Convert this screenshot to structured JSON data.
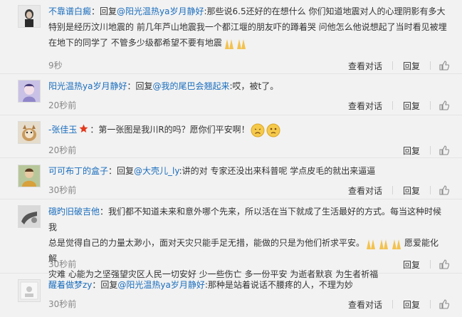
{
  "comments": [
    {
      "user": "不靠谱白癜",
      "reply_word": "：回复",
      "mention": "@阳光温热ya岁月静好",
      "text_prefix": ":",
      "text_l1": "那些说6.5还好的在想什么 你们知道地震对人的心理阴影有多大",
      "text_l2": "特别是经历汶川地震的 前几年芦山地震我一个都江堰的朋友吓的蹲着哭 问他怎么他说想起了当时看见被埋",
      "text_l3": "在地下的同学了 不管多少级都希望不要有地震",
      "time": "9秒",
      "actions": {
        "report": "查看对话",
        "reply": "回复"
      }
    },
    {
      "user": "阳光温热ya岁月静好",
      "reply_word": "：回复",
      "mention": "@我的尾巴会翘起来",
      "text": ":哎，被t了。",
      "time": "20秒前",
      "actions": {
        "report": "查看对话",
        "reply": "回复"
      }
    },
    {
      "user": "-张佳玉",
      "text": "：第一张图是我川R的吗？愿你们平安啊！",
      "time": "20秒前",
      "actions": {
        "reply": "回复"
      }
    },
    {
      "user": "可可布丁的盒子",
      "reply_word": "：回复",
      "mention": "@大壳儿_ly",
      "text": ":讲的对 专家还没出来科普呢 学点皮毛的就出来逼逼",
      "time": "30秒前",
      "actions": {
        "report": "查看对话",
        "reply": "回复"
      }
    },
    {
      "user": "硪旳旧破吉他",
      "text_l1": "：我们都不知道未来和意外哪个先来，所以活在当下就成了生活最好的方式。每当这种时候我",
      "text_l2": "总是觉得自己的力量太渺小，面对天灾只能手足无措，能做的只是为他们祈求平安。",
      "text_l2_tail": "愿爱能化解",
      "text_l3": "灾难 心能为之坚强望灾区人民一切安好 少一些伤亡 多一份平安 为逝者默哀 为生者祈福",
      "time": "30秒前",
      "actions": {
        "reply": "回复"
      }
    },
    {
      "user": "醒着做梦zy",
      "reply_word": "：回复",
      "mention": "@阳光温热ya岁月静好",
      "text": ":那种是站着说话不腰疼的人，不理为妙",
      "time": "30秒前",
      "actions": {
        "report": "查看对话",
        "reply": "回复"
      }
    }
  ]
}
